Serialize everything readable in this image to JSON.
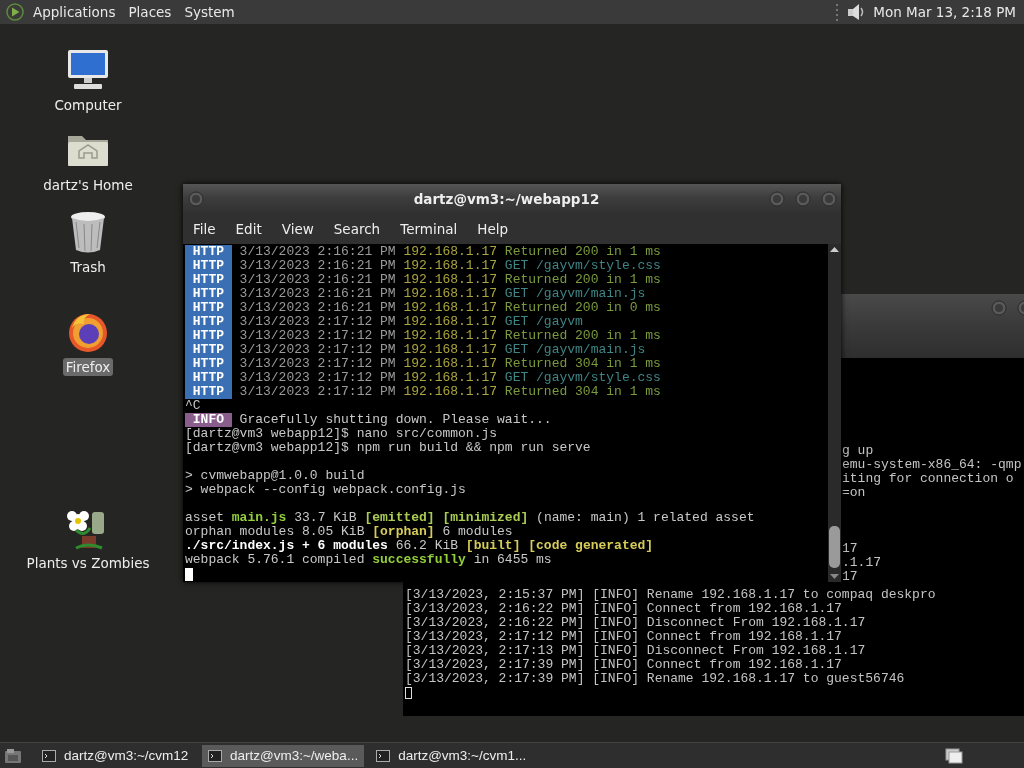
{
  "top_panel": {
    "menus": [
      "Applications",
      "Places",
      "System"
    ],
    "clock": "Mon Mar 13, 2:18 PM"
  },
  "desktop_icons": [
    {
      "label": "Computer",
      "kind": "computer",
      "selected": false
    },
    {
      "label": "dartz's Home",
      "kind": "home",
      "selected": false
    },
    {
      "label": "Trash",
      "kind": "trash",
      "selected": false
    },
    {
      "label": "Firefox",
      "kind": "browser",
      "selected": true
    },
    {
      "label": "Plants vs Zombies",
      "kind": "game",
      "selected": false
    }
  ],
  "back_window": {
    "upper_fragments": [
      "g up",
      "emu-system-x86_64: -qmp",
      "iting for connection o",
      "=on"
    ],
    "middle_fragments": [
      "17",
      ".1.17",
      "17"
    ],
    "lines": [
      "[3/13/2023, 2:15:37 PM] [INFO] Rename 192.168.1.17 to compaq deskpro",
      "[3/13/2023, 2:16:22 PM] [INFO] Connect from 192.168.1.17",
      "[3/13/2023, 2:16:22 PM] [INFO] Disconnect From 192.168.1.17",
      "[3/13/2023, 2:17:12 PM] [INFO] Connect from 192.168.1.17",
      "[3/13/2023, 2:17:13 PM] [INFO] Disconnect From 192.168.1.17",
      "[3/13/2023, 2:17:39 PM] [INFO] Connect from 192.168.1.17",
      "[3/13/2023, 2:17:39 PM] [INFO] Rename 192.168.1.17 to guest56746"
    ]
  },
  "front_window": {
    "title": "dartz@vm3:~/webapp12",
    "menu": [
      "File",
      "Edit",
      "View",
      "Search",
      "Terminal",
      "Help"
    ],
    "lines": [
      {
        "kind": "http",
        "badge": "HTTP",
        "segments": [
          {
            "text": "3/13/2023 2:16:21 PM ",
            "kind": "dim"
          },
          {
            "text": "192.168.1.17 ",
            "kind": "ip"
          },
          {
            "text": "Returned 200 in 1 ms",
            "kind": "ok"
          }
        ]
      },
      {
        "kind": "http",
        "badge": "HTTP",
        "segments": [
          {
            "text": "3/13/2023 2:16:21 PM ",
            "kind": "dim"
          },
          {
            "text": "192.168.1.17 ",
            "kind": "ip"
          },
          {
            "text": "GET /gayvm/style.css",
            "kind": "get"
          }
        ]
      },
      {
        "kind": "http",
        "badge": "HTTP",
        "segments": [
          {
            "text": "3/13/2023 2:16:21 PM ",
            "kind": "dim"
          },
          {
            "text": "192.168.1.17 ",
            "kind": "ip"
          },
          {
            "text": "Returned 200 in 1 ms",
            "kind": "ok"
          }
        ]
      },
      {
        "kind": "http",
        "badge": "HTTP",
        "segments": [
          {
            "text": "3/13/2023 2:16:21 PM ",
            "kind": "dim"
          },
          {
            "text": "192.168.1.17 ",
            "kind": "ip"
          },
          {
            "text": "GET /gayvm/main.js",
            "kind": "get"
          }
        ]
      },
      {
        "kind": "http",
        "badge": "HTTP",
        "segments": [
          {
            "text": "3/13/2023 2:16:21 PM ",
            "kind": "dim"
          },
          {
            "text": "192.168.1.17 ",
            "kind": "ip"
          },
          {
            "text": "Returned 200 in 0 ms",
            "kind": "ok"
          }
        ]
      },
      {
        "kind": "http",
        "badge": "HTTP",
        "segments": [
          {
            "text": "3/13/2023 2:17:12 PM ",
            "kind": "dim"
          },
          {
            "text": "192.168.1.17 ",
            "kind": "ip"
          },
          {
            "text": "GET /gayvm",
            "kind": "get"
          }
        ]
      },
      {
        "kind": "http",
        "badge": "HTTP",
        "segments": [
          {
            "text": "3/13/2023 2:17:12 PM ",
            "kind": "dim"
          },
          {
            "text": "192.168.1.17 ",
            "kind": "ip"
          },
          {
            "text": "Returned 200 in 1 ms",
            "kind": "ok"
          }
        ]
      },
      {
        "kind": "http",
        "badge": "HTTP",
        "segments": [
          {
            "text": "3/13/2023 2:17:12 PM ",
            "kind": "dim"
          },
          {
            "text": "192.168.1.17 ",
            "kind": "ip"
          },
          {
            "text": "GET /gayvm/main.js",
            "kind": "get"
          }
        ]
      },
      {
        "kind": "http",
        "badge": "HTTP",
        "segments": [
          {
            "text": "3/13/2023 2:17:12 PM ",
            "kind": "dim"
          },
          {
            "text": "192.168.1.17 ",
            "kind": "ip"
          },
          {
            "text": "Returned 304 in 1 ms",
            "kind": "ok"
          }
        ]
      },
      {
        "kind": "http",
        "badge": "HTTP",
        "segments": [
          {
            "text": "3/13/2023 2:17:12 PM ",
            "kind": "dim"
          },
          {
            "text": "192.168.1.17 ",
            "kind": "ip"
          },
          {
            "text": "GET /gayvm/style.css",
            "kind": "get"
          }
        ]
      },
      {
        "kind": "http",
        "badge": "HTTP",
        "segments": [
          {
            "text": "3/13/2023 2:17:12 PM ",
            "kind": "dim"
          },
          {
            "text": "192.168.1.17 ",
            "kind": "ip"
          },
          {
            "text": "Returned 304 in 1 ms",
            "kind": "ok"
          }
        ]
      },
      {
        "kind": "text",
        "segments": [
          {
            "text": "^C",
            "kind": "plain"
          }
        ]
      },
      {
        "kind": "info",
        "badge": "INFO",
        "segments": [
          {
            "text": "Gracefully shutting down. Please wait...",
            "kind": "plain"
          }
        ]
      },
      {
        "kind": "text",
        "segments": [
          {
            "text": "[dartz@vm3 webapp12]$ nano src/common.js",
            "kind": "plain"
          }
        ]
      },
      {
        "kind": "text",
        "segments": [
          {
            "text": "[dartz@vm3 webapp12]$ npm run build && npm run serve",
            "kind": "plain"
          }
        ]
      },
      {
        "kind": "blank"
      },
      {
        "kind": "text",
        "segments": [
          {
            "text": "> cvmwebapp@1.0.0 build",
            "kind": "plain"
          }
        ]
      },
      {
        "kind": "text",
        "segments": [
          {
            "text": "> webpack --config webpack.config.js",
            "kind": "plain"
          }
        ]
      },
      {
        "kind": "blank"
      },
      {
        "kind": "text",
        "segments": [
          {
            "text": "asset ",
            "kind": "plain"
          },
          {
            "text": "main.js",
            "kind": "lime"
          },
          {
            "text": " 33.7 KiB ",
            "kind": "plain"
          },
          {
            "text": "[emitted] ",
            "kind": "green"
          },
          {
            "text": "[minimized]",
            "kind": "green"
          },
          {
            "text": " (name: main) 1 related asset",
            "kind": "plain"
          }
        ]
      },
      {
        "kind": "text",
        "segments": [
          {
            "text": "orphan modules 8.05 KiB ",
            "kind": "plain"
          },
          {
            "text": "[orphan]",
            "kind": "yellow"
          },
          {
            "text": " 6 modules",
            "kind": "plain"
          }
        ]
      },
      {
        "kind": "text",
        "segments": [
          {
            "text": "./src/index.js + 6 modules",
            "kind": "bold"
          },
          {
            "text": " 66.2 KiB ",
            "kind": "plain"
          },
          {
            "text": "[built] [code generated]",
            "kind": "yellow"
          }
        ]
      },
      {
        "kind": "text",
        "segments": [
          {
            "text": "webpack 5.76.1 compiled ",
            "kind": "plain"
          },
          {
            "text": "successfully",
            "kind": "lime"
          },
          {
            "text": " in 6455 ms",
            "kind": "plain"
          }
        ]
      },
      {
        "kind": "cursor"
      }
    ]
  },
  "taskbar": {
    "tasks": [
      {
        "label": "dartz@vm3:~/cvm12",
        "selected": false
      },
      {
        "label": "dartz@vm3:~/weba...",
        "selected": true
      },
      {
        "label": "dartz@vm3:~/cvm1...",
        "selected": false
      }
    ]
  }
}
